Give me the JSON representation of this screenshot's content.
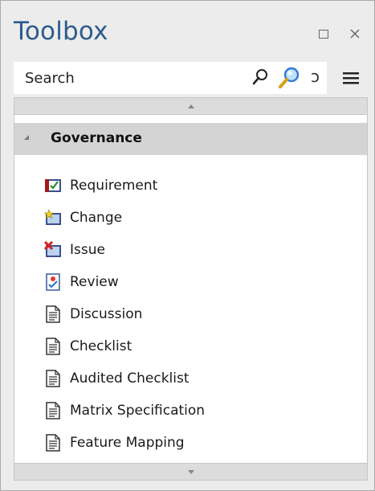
{
  "toolbox": {
    "title": "Toolbox",
    "search_placeholder": "Search",
    "group": {
      "label": "Governance",
      "items": [
        {
          "label": "Requirement",
          "icon": "requirement-icon"
        },
        {
          "label": "Change",
          "icon": "change-icon"
        },
        {
          "label": "Issue",
          "icon": "issue-icon"
        },
        {
          "label": "Review",
          "icon": "review-icon"
        },
        {
          "label": "Discussion",
          "icon": "document-icon"
        },
        {
          "label": "Checklist",
          "icon": "document-icon"
        },
        {
          "label": "Audited Checklist",
          "icon": "document-icon"
        },
        {
          "label": "Matrix Specification",
          "icon": "document-icon"
        },
        {
          "label": "Feature Mapping",
          "icon": "document-icon"
        }
      ]
    }
  },
  "colors": {
    "title": "#2f5b8e",
    "panel_bg": "#ececec",
    "group_header_bg": "#d4d4d4",
    "content_bg": "#ffffff"
  }
}
